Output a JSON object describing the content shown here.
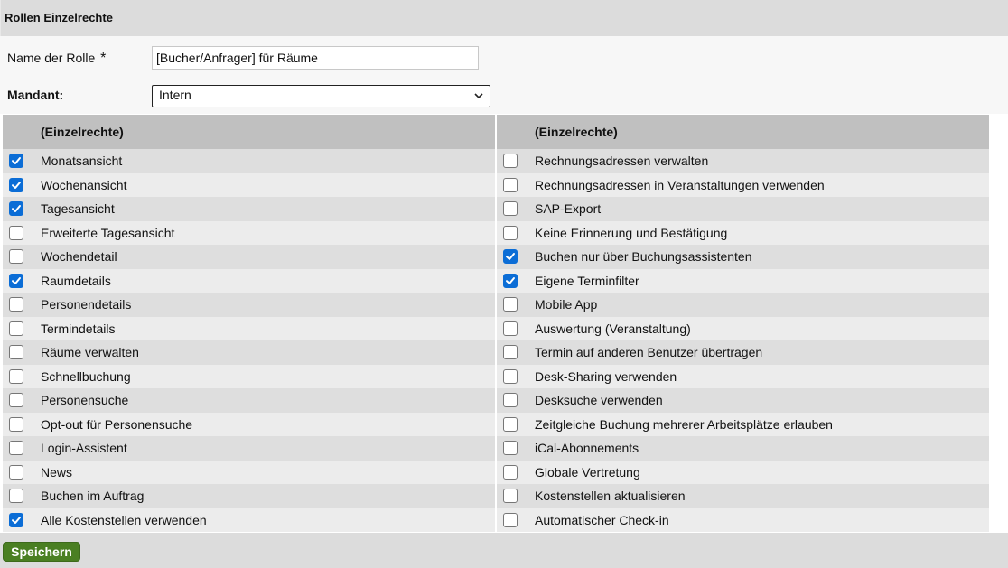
{
  "title": "Rollen Einzelrechte",
  "form": {
    "name_label": "Name der Rolle",
    "required_mark": "*",
    "name_value": "[Bucher/Anfrager] für Räume",
    "mandant_label": "Mandant:",
    "mandant_value": "Intern"
  },
  "left": {
    "header": "(Einzelrechte)",
    "items": [
      {
        "label": "Monatsansicht",
        "checked": true
      },
      {
        "label": "Wochenansicht",
        "checked": true
      },
      {
        "label": "Tagesansicht",
        "checked": true
      },
      {
        "label": "Erweiterte Tagesansicht",
        "checked": false
      },
      {
        "label": "Wochendetail",
        "checked": false
      },
      {
        "label": "Raumdetails",
        "checked": true
      },
      {
        "label": "Personendetails",
        "checked": false
      },
      {
        "label": "Termindetails",
        "checked": false
      },
      {
        "label": "Räume verwalten",
        "checked": false
      },
      {
        "label": "Schnellbuchung",
        "checked": false
      },
      {
        "label": "Personensuche",
        "checked": false
      },
      {
        "label": "Opt-out für Personensuche",
        "checked": false
      },
      {
        "label": "Login-Assistent",
        "checked": false
      },
      {
        "label": "News",
        "checked": false
      },
      {
        "label": "Buchen im Auftrag",
        "checked": false
      },
      {
        "label": "Alle Kostenstellen verwenden",
        "checked": true
      }
    ]
  },
  "right": {
    "header": "(Einzelrechte)",
    "items": [
      {
        "label": "Rechnungsadressen verwalten",
        "checked": false
      },
      {
        "label": "Rechnungsadressen in Veranstaltungen verwenden",
        "checked": false
      },
      {
        "label": "SAP-Export",
        "checked": false
      },
      {
        "label": "Keine Erinnerung und Bestätigung",
        "checked": false
      },
      {
        "label": "Buchen nur über Buchungsassistenten",
        "checked": true
      },
      {
        "label": "Eigene Terminfilter",
        "checked": true
      },
      {
        "label": "Mobile App",
        "checked": false
      },
      {
        "label": "Auswertung (Veranstaltung)",
        "checked": false
      },
      {
        "label": "Termin auf anderen Benutzer übertragen",
        "checked": false
      },
      {
        "label": "Desk-Sharing verwenden",
        "checked": false
      },
      {
        "label": "Desksuche verwenden",
        "checked": false
      },
      {
        "label": "Zeitgleiche Buchung mehrerer Arbeitsplätze erlauben",
        "checked": false
      },
      {
        "label": "iCal-Abonnements",
        "checked": false
      },
      {
        "label": "Globale Vertretung",
        "checked": false
      },
      {
        "label": "Kostenstellen aktualisieren",
        "checked": false
      },
      {
        "label": "Automatischer Check-in",
        "checked": false
      }
    ]
  },
  "footer": {
    "save_label": "Speichern"
  },
  "colors": {
    "checkbox_checked": "#0b6dd6",
    "save_button": "#4a7f22"
  },
  "icons": {
    "checkbox_check": "check-icon",
    "select_chevron": "chevron-down-icon"
  }
}
